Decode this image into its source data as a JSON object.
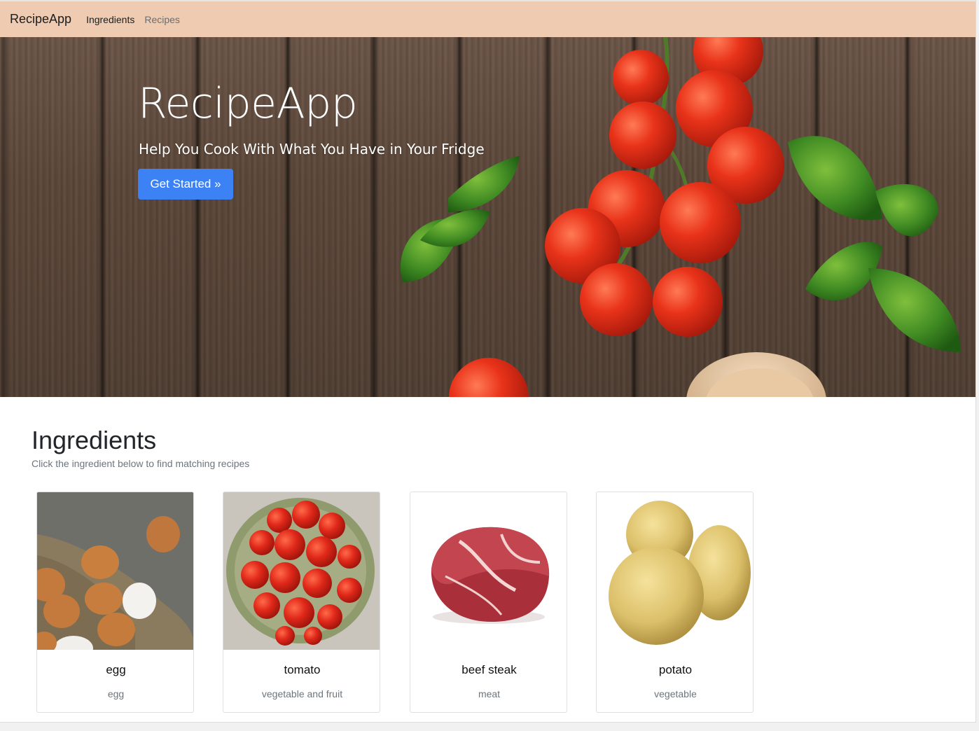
{
  "navbar": {
    "brand": "RecipeApp",
    "links": [
      "Ingredients",
      "Recipes"
    ]
  },
  "hero": {
    "title": "RecipeApp",
    "subtitle": "Help You Cook With What You Have in Your Fridge",
    "cta_label": "Get Started »"
  },
  "ingredients": {
    "title": "Ingredients",
    "subtitle": "Click the ingredient below to find matching recipes",
    "items": [
      {
        "name": "egg",
        "category": "egg"
      },
      {
        "name": "tomato",
        "category": "vegetable and fruit"
      },
      {
        "name": "beef steak",
        "category": "meat"
      },
      {
        "name": "potato",
        "category": "vegetable"
      }
    ]
  },
  "colors": {
    "navbar_bg": "#eecbb1",
    "cta_bg": "#3d82f4",
    "muted_text": "#6c757d"
  }
}
